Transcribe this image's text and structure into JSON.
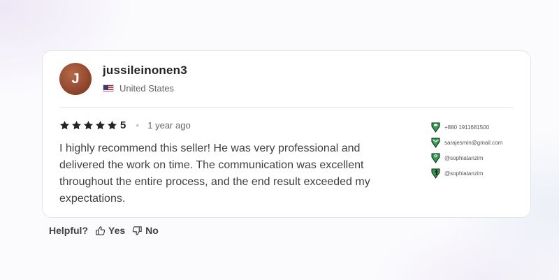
{
  "review": {
    "avatar_letter": "J",
    "username": "jussileinonen3",
    "country": "United States",
    "country_flag_icon": "us-flag-icon",
    "rating": {
      "stars": 5,
      "value": "5",
      "star_color": "#222325"
    },
    "separator": "•",
    "time_ago": "1 year ago",
    "text": "I highly recommend this seller! He was very professional and delivered the work on time. The communication was excellent throughout the entire process, and the end result exceeded my expectations."
  },
  "contacts": [
    {
      "icon": "phone-icon",
      "text": "+880 1911681500"
    },
    {
      "icon": "mail-icon",
      "text": "sarajesmin@gmail.com"
    },
    {
      "icon": "instagram-icon",
      "text": "@sophiatanzim"
    },
    {
      "icon": "facebook-icon",
      "text": "@sophiatanzim"
    }
  ],
  "feedback": {
    "label": "Helpful?",
    "yes_label": "Yes",
    "no_label": "No"
  },
  "colors": {
    "accent_green": "#1dbf73",
    "text_dark": "#222325",
    "text_muted": "#62646a"
  }
}
